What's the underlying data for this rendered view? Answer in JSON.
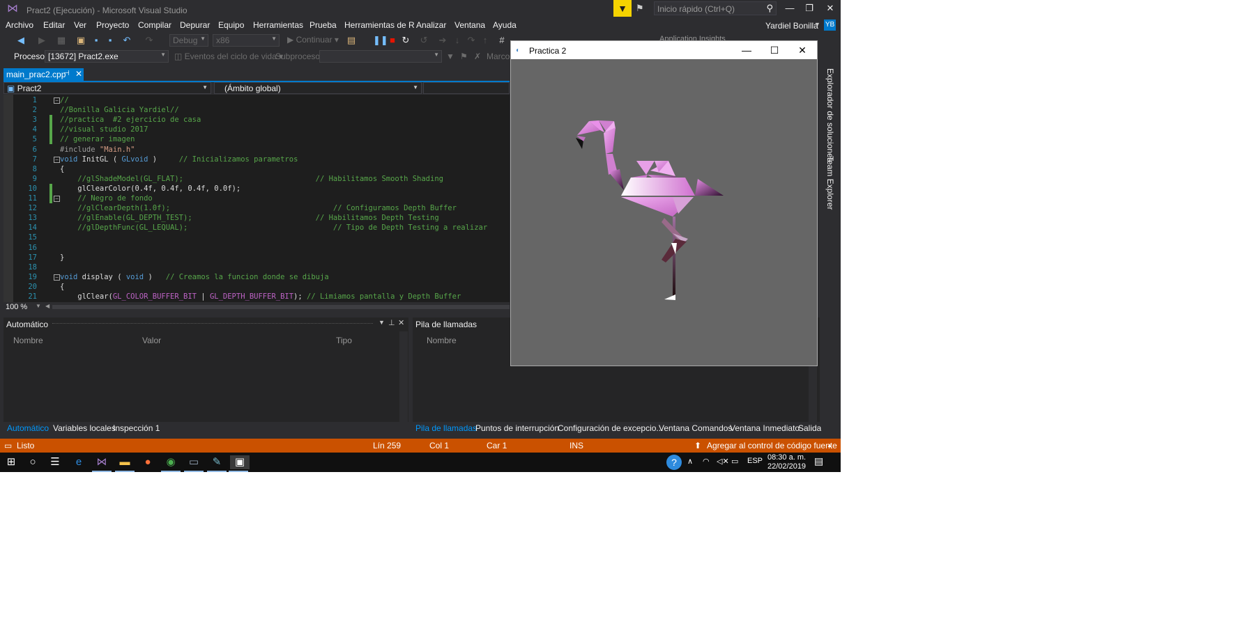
{
  "vs": {
    "window_title": "Pract2 (Ejecución) - Microsoft Visual Studio",
    "quick_launch_placeholder": "Inicio rápido (Ctrl+Q)",
    "menu": [
      "Archivo",
      "Editar",
      "Ver",
      "Proyecto",
      "Compilar",
      "Depurar",
      "Equipo",
      "Herramientas",
      "Prueba",
      "Herramientas de R",
      "Analizar",
      "Ventana",
      "Ayuda"
    ],
    "user_name": "Yardiel Bonilla",
    "user_initials": "YB",
    "toolbar": {
      "config": "Debug",
      "platform": "x86",
      "continue_label": "Continuar",
      "app_insights": "Application Insights"
    },
    "debug_bar": {
      "process_label": "Proceso:",
      "process_value": "[13672] Pract2.exe",
      "lifecycle_label": "Eventos del ciclo de vida",
      "thread_label": "Subproceso:",
      "frame_label": "Marco"
    },
    "doc_tab": {
      "label": "main_prac2.cpp",
      "pin": "⊣",
      "close": "✕"
    },
    "nav": {
      "project": "Pract2",
      "scope": "(Ámbito global)"
    },
    "code_lines": [
      {
        "n": "1",
        "t": "//"
      },
      {
        "n": "2",
        "t": "//Bonilla Galicia Yardiel//"
      },
      {
        "n": "3",
        "t": "//practica  #2 ejercicio de casa"
      },
      {
        "n": "4",
        "t": "//visual studio 2017"
      },
      {
        "n": "5",
        "t": "// generar imagen"
      },
      {
        "n": "6",
        "t": "#include \"Main.h\""
      },
      {
        "n": "7",
        "t": "void InitGL ( GLvoid )     // Inicializamos parametros"
      },
      {
        "n": "8",
        "t": "{"
      },
      {
        "n": "9",
        "t": "    //glShadeModel(GL_FLAT);                              // Habilitamos Smooth Shading"
      },
      {
        "n": "10",
        "t": "    glClearColor(0.4f, 0.4f, 0.4f, 0.0f);"
      },
      {
        "n": "11",
        "t": "    // Negro de fondo"
      },
      {
        "n": "12",
        "t": "    //glClearDepth(1.0f);                                     // Configuramos Depth Buffer"
      },
      {
        "n": "13",
        "t": "    //glEnable(GL_DEPTH_TEST);                            // Habilitamos Depth Testing"
      },
      {
        "n": "14",
        "t": "    //glDepthFunc(GL_LEQUAL);                                 // Tipo de Depth Testing a realizar"
      },
      {
        "n": "15",
        "t": ""
      },
      {
        "n": "16",
        "t": ""
      },
      {
        "n": "17",
        "t": "}"
      },
      {
        "n": "18",
        "t": ""
      },
      {
        "n": "19",
        "t": "void display ( void )   // Creamos la funcion donde se dibuja"
      },
      {
        "n": "20",
        "t": "{"
      },
      {
        "n": "21",
        "t": "    glClear(GL_COLOR_BUFFER_BIT | GL_DEPTH_BUFFER_BIT); // Limiamos pantalla y Depth Buffer"
      }
    ],
    "zoom": "100 %",
    "autos_panel": {
      "title": "Automático",
      "columns": [
        "Nombre",
        "Valor",
        "Tipo"
      ]
    },
    "callstack_panel": {
      "title": "Pila de llamadas",
      "columns": [
        "Nombre"
      ]
    },
    "bottom_tabs_left": [
      "Automático",
      "Variables locales",
      "Inspección 1"
    ],
    "bottom_tabs_right": [
      "Pila de llamadas",
      "Puntos de interrupción",
      "Configuración de excepcio...",
      "Ventana Comandos",
      "Ventana Inmediato",
      "Salida"
    ],
    "status": {
      "ready": "Listo",
      "line": "Lín 259",
      "col": "Col 1",
      "char": "Car 1",
      "mode": "INS",
      "source_control": "Agregar al control de código fuente"
    },
    "side_tabs": [
      "Explorador de soluciones",
      "Team Explorer"
    ]
  },
  "gl_window": {
    "title": "Practica 2",
    "minimize": "—",
    "maximize": "☐",
    "close": "✕",
    "background_color": "#666666"
  },
  "taskbar": {
    "language": "ESP",
    "time": "08:30 a. m.",
    "date": "22/02/2019"
  },
  "colors": {
    "accent": "#007acc",
    "status": "#ca5100",
    "flamingo_pink": "#e890e8"
  }
}
